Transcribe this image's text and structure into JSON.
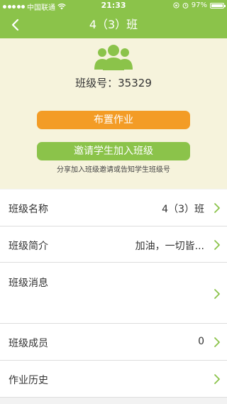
{
  "status_bar": {
    "carrier": "中国联通",
    "time": "21:33",
    "battery": "97%",
    "battery_level": 0.97
  },
  "nav": {
    "title": "4（3）班",
    "back_icon": "chevron-left-icon"
  },
  "header": {
    "group_icon": "group-icon",
    "class_number_label": "班级号：",
    "class_number": "35329",
    "assign_button": "布置作业",
    "invite_button": "邀请学生加入班级",
    "invite_hint": "分享加入班级邀请或告知学生班级号"
  },
  "list": {
    "rows": [
      {
        "label": "班级名称",
        "value": "4（3）班"
      },
      {
        "label": "班级简介",
        "value": "加油，一切皆..."
      },
      {
        "label": "班级消息",
        "value": ""
      },
      {
        "label": "班级成员",
        "value": "0"
      },
      {
        "label": "作业历史",
        "value": ""
      }
    ]
  },
  "colors": {
    "accent_green": "#8bc34a",
    "accent_orange": "#f39c26",
    "header_bg": "#f6f3dc"
  }
}
